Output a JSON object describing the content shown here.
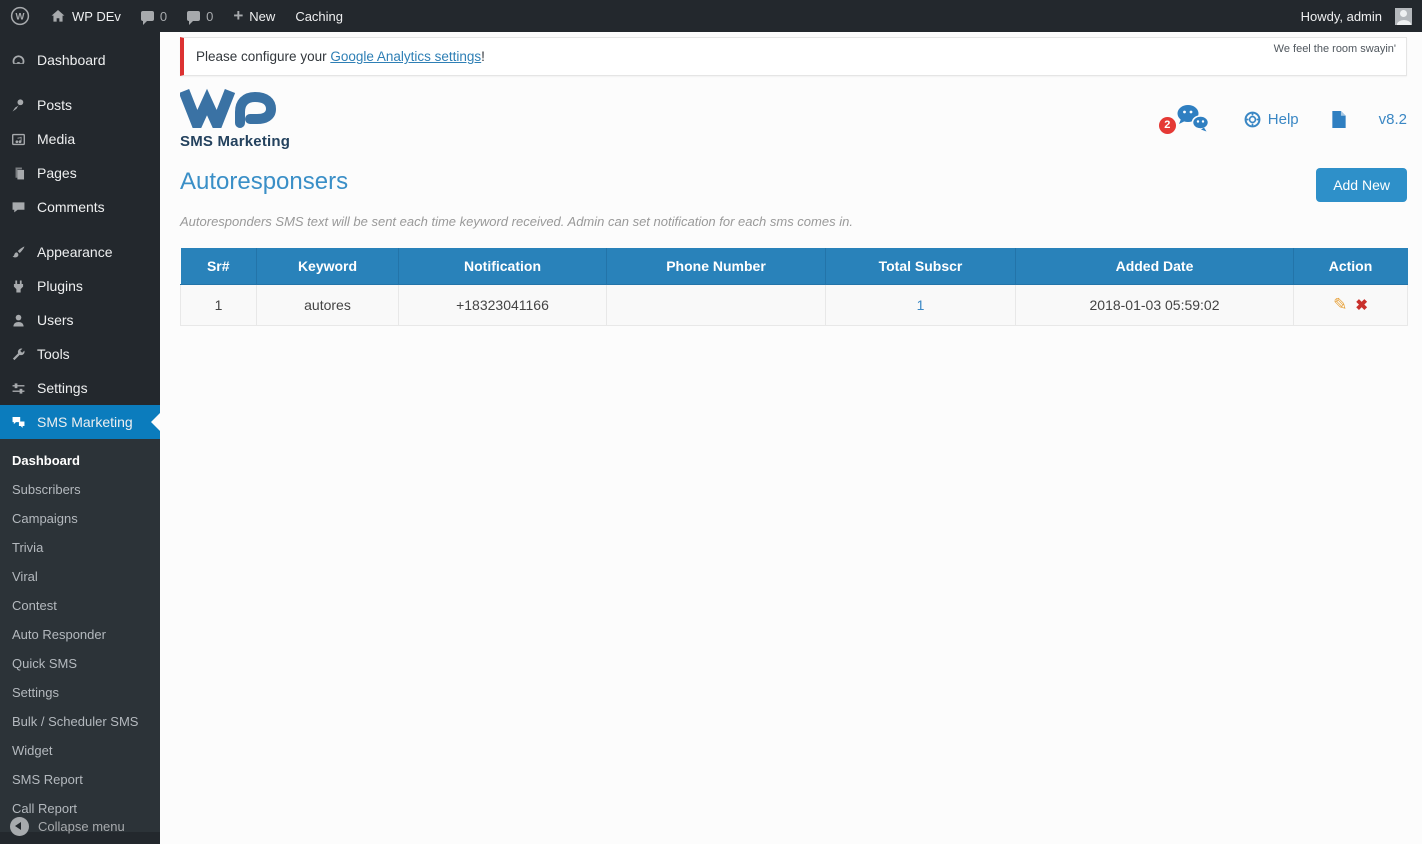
{
  "admin_bar": {
    "site_name": "WP DEv",
    "comment_count_1": "0",
    "comment_count_2": "0",
    "new_label": "New",
    "caching_label": "Caching",
    "howdy": "Howdy, admin"
  },
  "sidebar": {
    "items": [
      {
        "label": "Dashboard"
      },
      {
        "label": "Posts"
      },
      {
        "label": "Media"
      },
      {
        "label": "Pages"
      },
      {
        "label": "Comments"
      },
      {
        "label": "Appearance"
      },
      {
        "label": "Plugins"
      },
      {
        "label": "Users"
      },
      {
        "label": "Tools"
      },
      {
        "label": "Settings"
      },
      {
        "label": "SMS Marketing"
      }
    ],
    "submenu": [
      "Dashboard",
      "Subscribers",
      "Campaigns",
      "Trivia",
      "Viral",
      "Contest",
      "Auto Responder",
      "Quick SMS",
      "Settings",
      "Bulk / Scheduler SMS",
      "Widget",
      "SMS Report",
      "Call Report"
    ],
    "collapse_label": "Collapse menu"
  },
  "notice": {
    "text_before": "Please configure your ",
    "link_text": "Google Analytics settings",
    "text_after": "!",
    "dolly_text": "We feel the room swayin'"
  },
  "plugin_header": {
    "logo_subtitle": "SMS Marketing",
    "chat_badge_count": "2",
    "help_label": "Help",
    "version": "v8.2"
  },
  "page": {
    "title": "Autoresponsers",
    "description": "Autoresponders SMS text will be sent each time keyword received. Admin can set notification for each sms comes in.",
    "add_new_label": "Add New"
  },
  "table": {
    "headers": [
      "Sr#",
      "Keyword",
      "Notification",
      "Phone Number",
      "Total Subscr",
      "Added Date",
      "Action"
    ],
    "rows": [
      {
        "sr": "1",
        "keyword": "autores",
        "notification": "+18323041166",
        "phone": "",
        "total_subscr": "1",
        "added_date": "2018-01-03 05:59:02"
      }
    ]
  },
  "icons": {
    "edit": "✎",
    "delete": "✖"
  },
  "colors": {
    "admin_bar_bg": "#23282d",
    "sidebar_bg": "#23282d",
    "submenu_bg": "#2c3338",
    "active_item_bg": "#0b7cbd",
    "accent_blue": "#3a87c4",
    "table_header_bg": "#2982ba",
    "button_bg": "#2e90c9",
    "notice_border_red": "#dc3232",
    "badge_red": "#e53935",
    "delete_red": "#c9302c",
    "pencil_orange": "#e8a33d"
  }
}
